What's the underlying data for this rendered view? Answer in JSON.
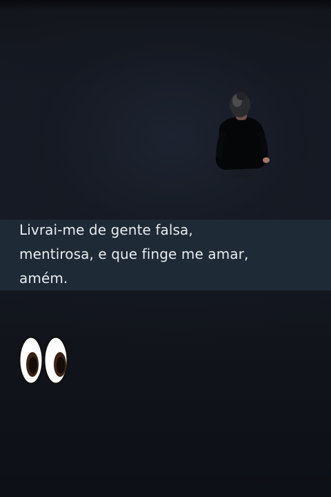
{
  "caption": {
    "lines": [
      "Livrai-me de gente falsa,",
      "mentirosa, e que finge me amar,",
      "amém."
    ]
  },
  "sticker": {
    "icon": "eyes-emoji-icon"
  },
  "colors": {
    "background": "#141821",
    "caption_bar": "#1e2a35",
    "caption_text": "#e9ecef"
  }
}
